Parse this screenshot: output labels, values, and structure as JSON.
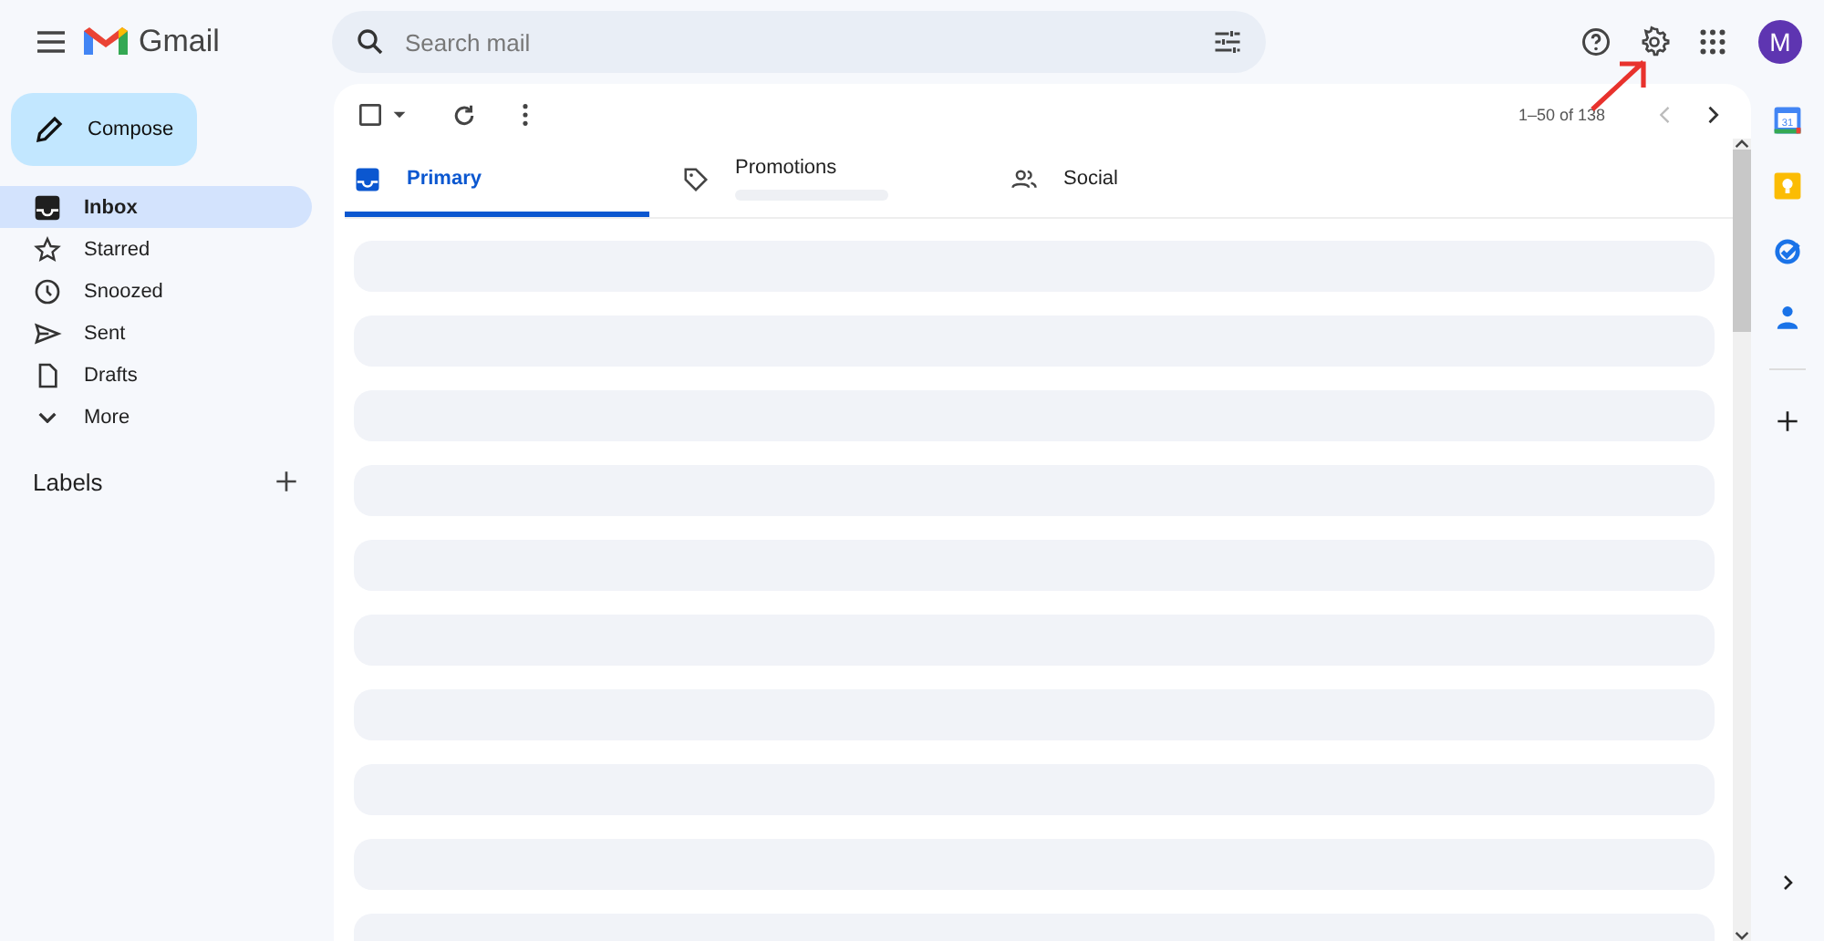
{
  "app": {
    "name": "Gmail",
    "avatar": "M"
  },
  "search": {
    "placeholder": "Search mail"
  },
  "compose": {
    "label": "Compose"
  },
  "sidebar": {
    "items": [
      {
        "label": "Inbox",
        "selected": true
      },
      {
        "label": "Starred",
        "selected": false
      },
      {
        "label": "Snoozed",
        "selected": false
      },
      {
        "label": "Sent",
        "selected": false
      },
      {
        "label": "Drafts",
        "selected": false
      },
      {
        "label": "More",
        "selected": false
      }
    ],
    "labels_heading": "Labels"
  },
  "toolbar": {
    "pagination": "1–50 of 138"
  },
  "tabs": [
    {
      "label": "Primary",
      "selected": true,
      "loading": false
    },
    {
      "label": "Promotions",
      "selected": false,
      "loading": true
    },
    {
      "label": "Social",
      "selected": false,
      "loading": false
    }
  ],
  "side_rail": {
    "calendar_day": "31"
  }
}
